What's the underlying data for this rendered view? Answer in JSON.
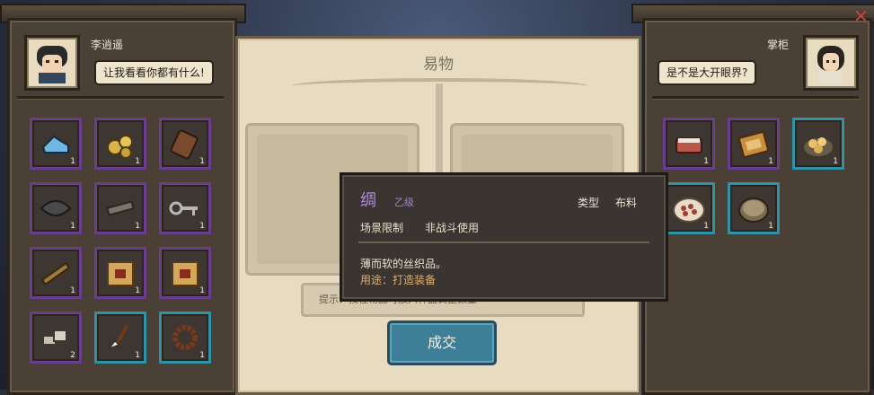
{
  "left": {
    "name": "李逍遥",
    "speech": "让我看看你都有什么!",
    "items": [
      {
        "icon": "blue-shoes-icon",
        "count": "1",
        "frame": "purple"
      },
      {
        "icon": "gold-ore-icon",
        "count": "1",
        "frame": "purple"
      },
      {
        "icon": "wood-case-icon",
        "count": "1",
        "frame": "purple"
      },
      {
        "icon": "dark-leaf-icon",
        "count": "1",
        "frame": "purple"
      },
      {
        "icon": "iron-bar-icon",
        "count": "1",
        "frame": "purple"
      },
      {
        "icon": "key-icon",
        "count": "1",
        "frame": "purple"
      },
      {
        "icon": "bamboo-stick-icon",
        "count": "1",
        "frame": "purple"
      },
      {
        "icon": "scroll-map-icon",
        "count": "1",
        "frame": "purple"
      },
      {
        "icon": "scroll-map-icon",
        "count": "1",
        "frame": "purple"
      },
      {
        "icon": "stone-pile-icon",
        "count": "2",
        "frame": "purple"
      },
      {
        "icon": "brush-icon",
        "count": "1",
        "frame": "blue"
      },
      {
        "icon": "bead-bracelet-icon",
        "count": "1",
        "frame": "blue"
      }
    ]
  },
  "right": {
    "name": "掌柜",
    "speech": "是不是大开眼界?",
    "items": [
      {
        "icon": "meat-icon",
        "count": "1",
        "frame": "purple"
      },
      {
        "icon": "box-icon",
        "count": "1",
        "frame": "purple"
      },
      {
        "icon": "bread-plate-icon",
        "count": "1",
        "frame": "blue"
      },
      {
        "icon": "dumpling-plate-icon",
        "count": "1",
        "frame": "blue"
      },
      {
        "icon": "steamer-icon",
        "count": "1",
        "frame": "blue"
      }
    ]
  },
  "center": {
    "title": "易物",
    "hint": "提示：按住物品可放入秤盘调整数量",
    "trade_button": "成交"
  },
  "tooltip": {
    "name": "绸",
    "grade": "乙级",
    "type_label": "类型",
    "type_value": "布料",
    "scene_label": "场景限制",
    "scene_value": "非战斗使用",
    "desc": "薄而软的丝织品。",
    "use": "用途：打造装备"
  },
  "colors": {
    "purple_frame": "#6b3d8f",
    "blue_frame": "#2f93a8",
    "trade_button": "#3e7f98"
  }
}
